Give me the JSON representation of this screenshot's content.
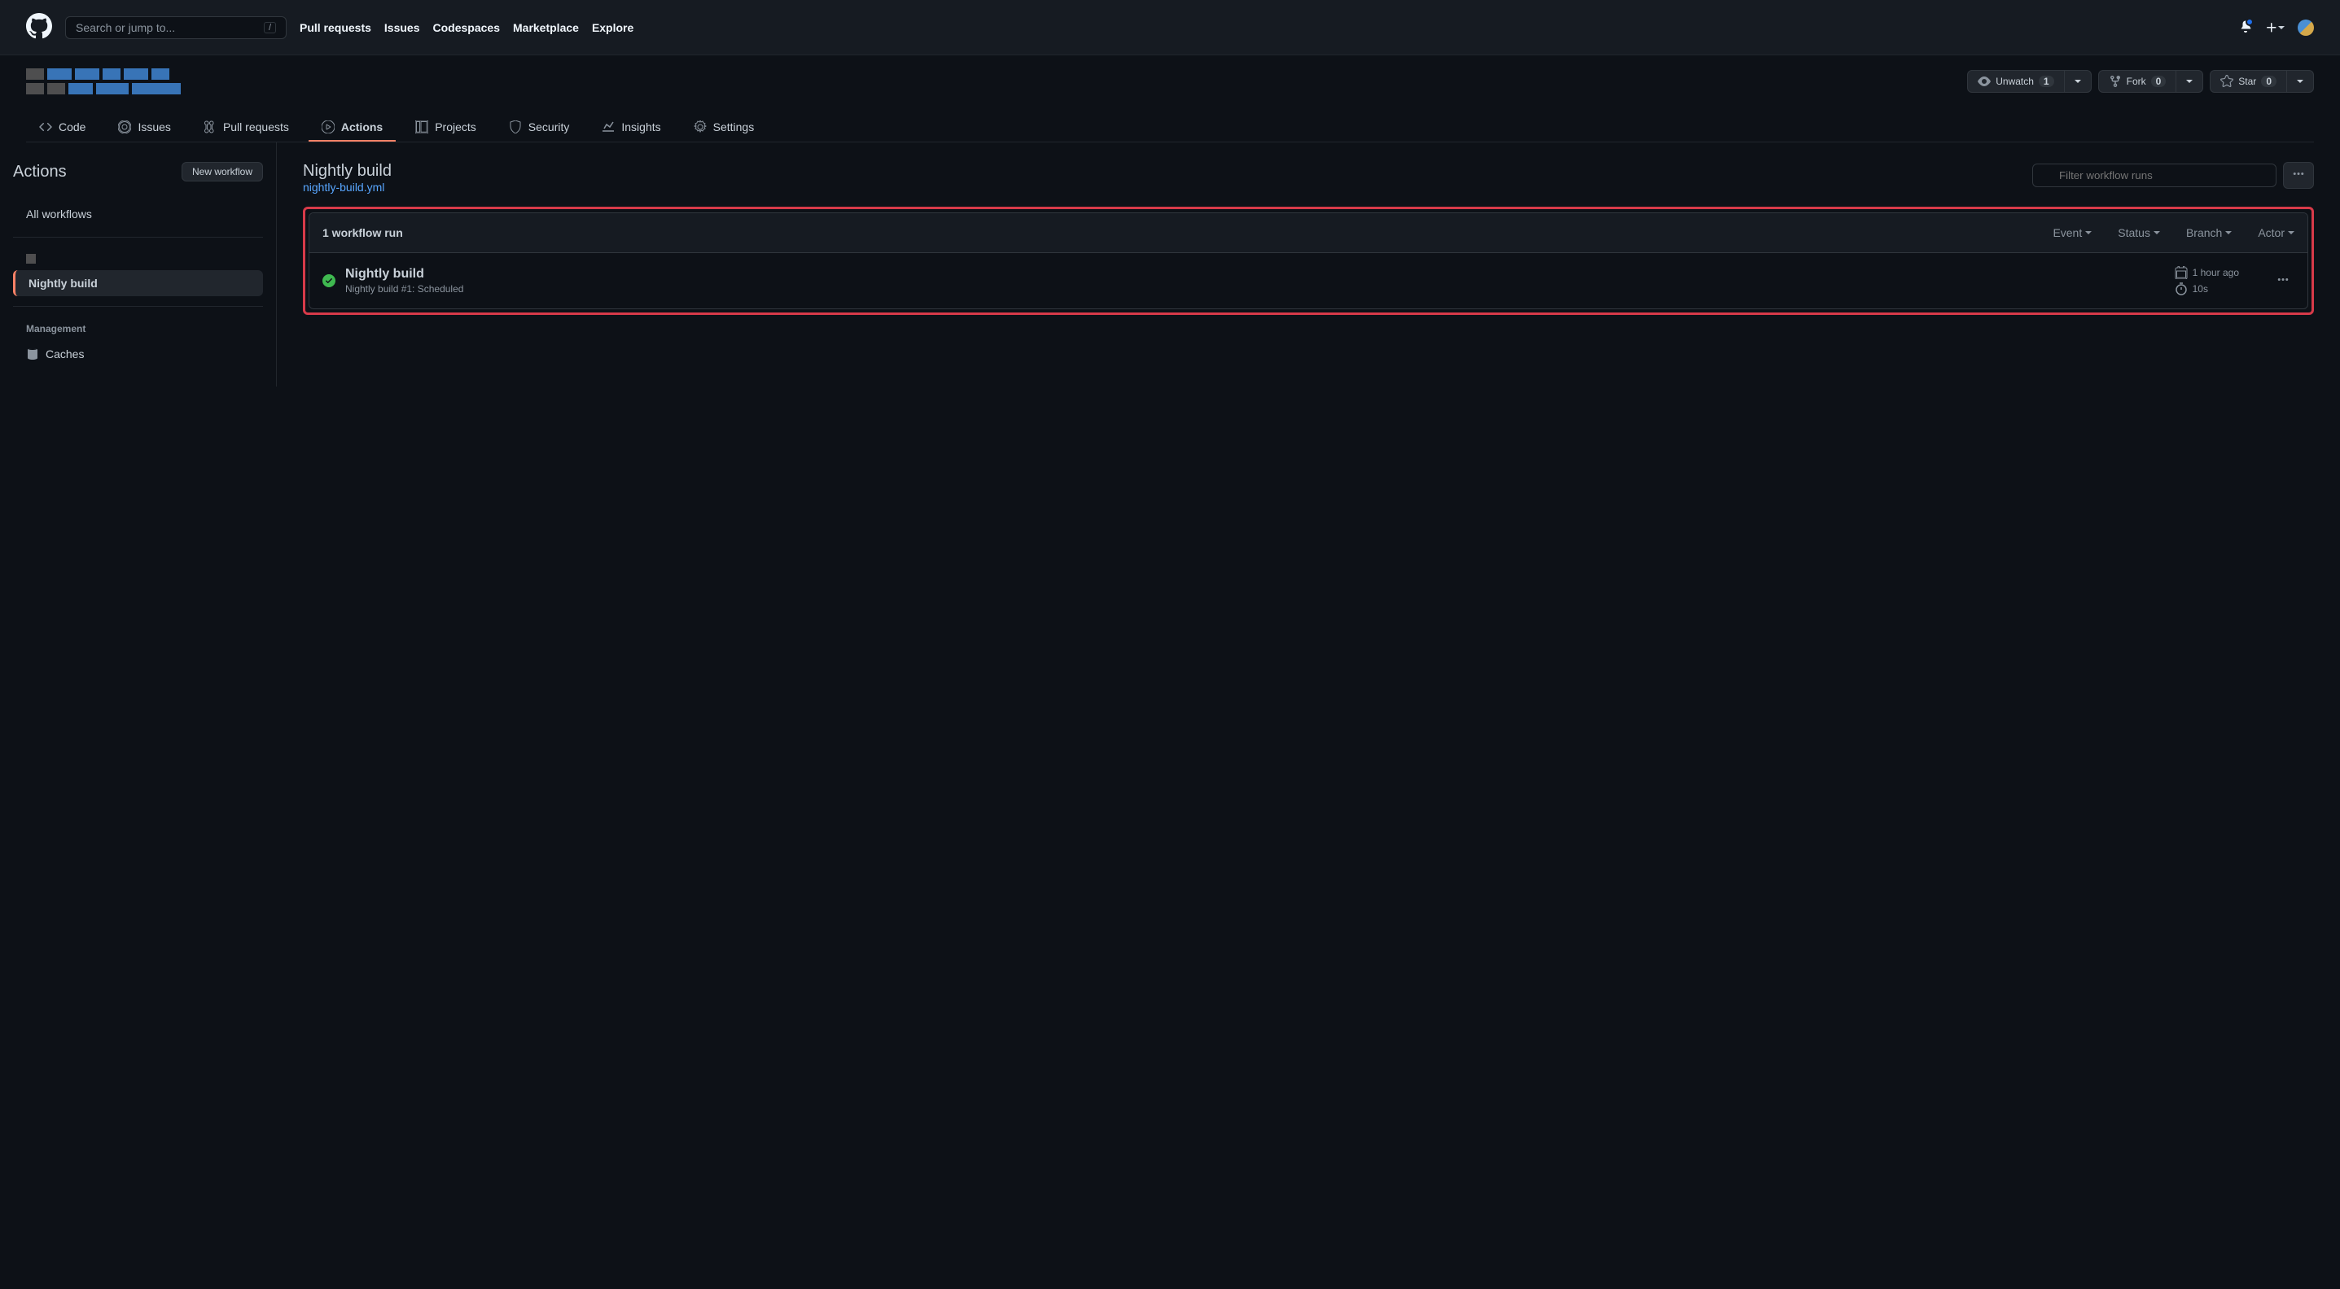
{
  "header": {
    "search_placeholder": "Search or jump to...",
    "search_key": "/",
    "nav": [
      "Pull requests",
      "Issues",
      "Codespaces",
      "Marketplace",
      "Explore"
    ]
  },
  "repo": {
    "unwatch": "Unwatch",
    "unwatch_count": "1",
    "fork": "Fork",
    "fork_count": "0",
    "star": "Star",
    "star_count": "0"
  },
  "tabs": {
    "code": "Code",
    "issues": "Issues",
    "pull_requests": "Pull requests",
    "actions": "Actions",
    "projects": "Projects",
    "security": "Security",
    "insights": "Insights",
    "settings": "Settings"
  },
  "sidebar": {
    "title": "Actions",
    "new_workflow": "New workflow",
    "all_workflows": "All workflows",
    "nightly": "Nightly build",
    "management": "Management",
    "caches": "Caches"
  },
  "main": {
    "title": "Nightly build",
    "yml": "nightly-build.yml",
    "filter_placeholder": "Filter workflow runs",
    "runs_count": "1 workflow run",
    "filters": {
      "event": "Event",
      "status": "Status",
      "branch": "Branch",
      "actor": "Actor"
    },
    "run": {
      "title": "Nightly build",
      "sub_prefix": "Nightly build",
      "sub_suffix": " #1: Scheduled",
      "time": "1 hour ago",
      "duration": "10s"
    }
  }
}
